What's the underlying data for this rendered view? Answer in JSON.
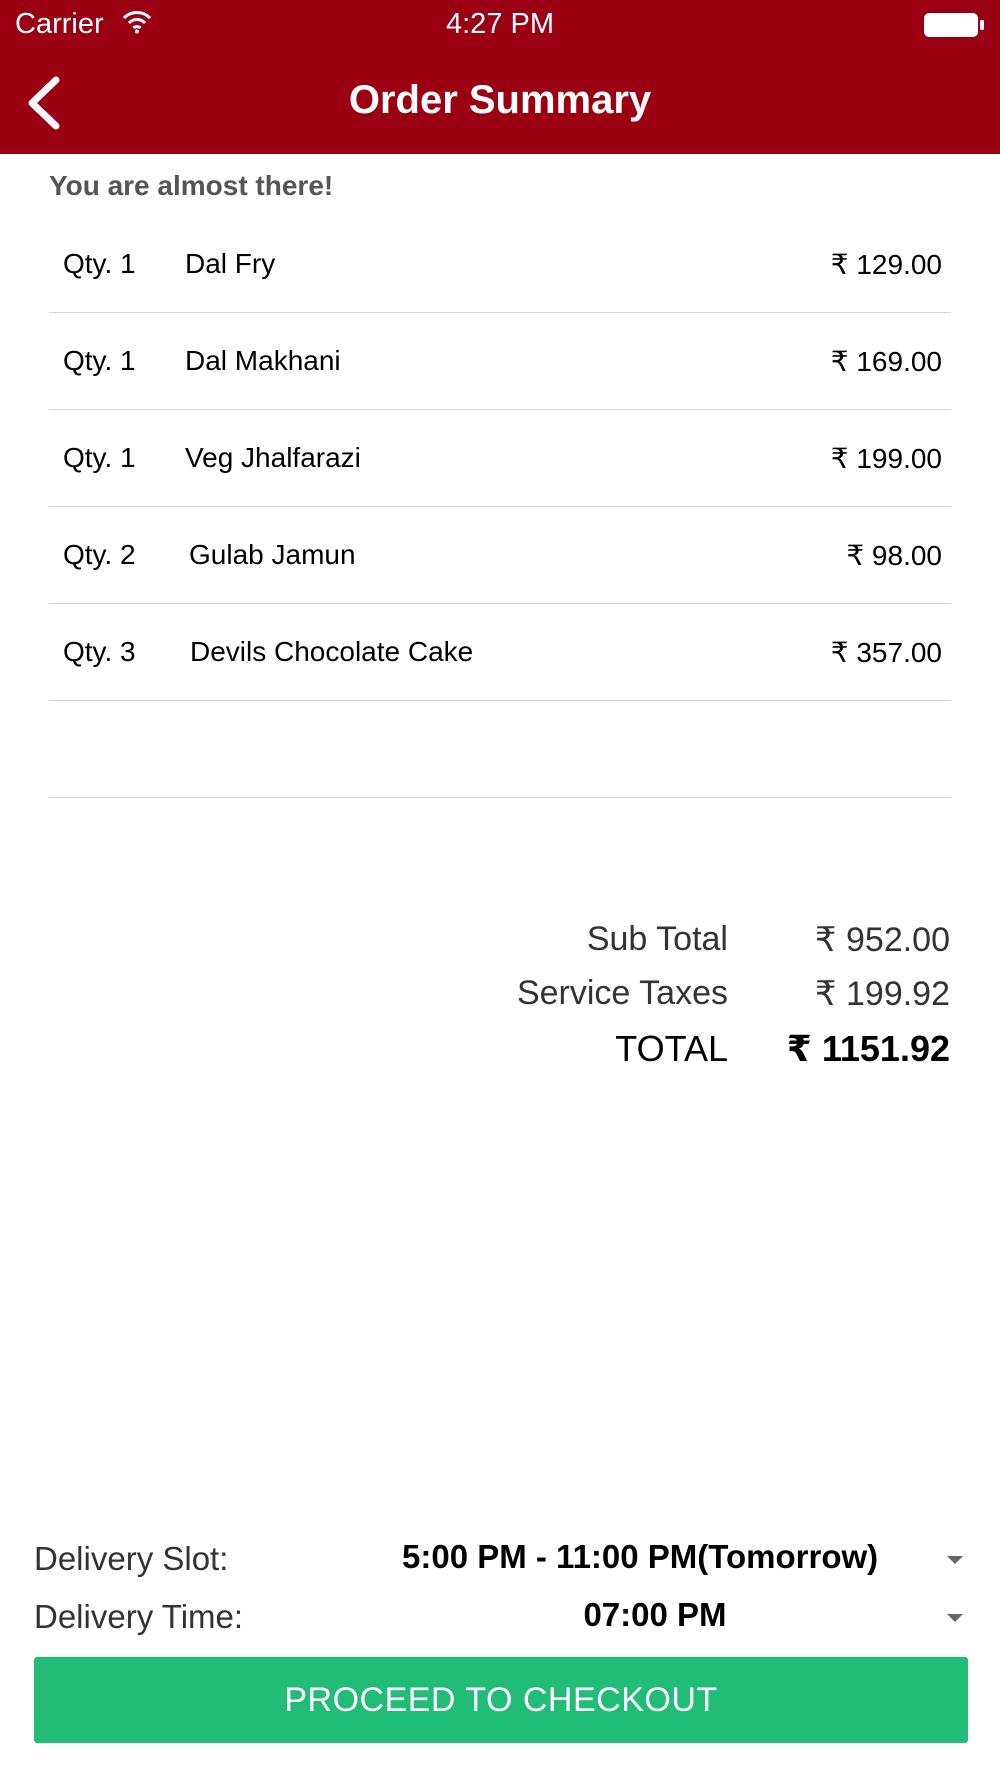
{
  "status_bar": {
    "carrier": "Carrier",
    "time": "4:27 PM"
  },
  "nav": {
    "title": "Order Summary",
    "back_icon": "chevron-left-icon"
  },
  "subtitle": "You are almost there!",
  "currency_symbol": "₹",
  "items": [
    {
      "qty_label": "Qty. 1",
      "name": "Dal Fry",
      "price": "₹ 129.00"
    },
    {
      "qty_label": "Qty. 1",
      "name": "Dal Makhani",
      "price": "₹ 169.00"
    },
    {
      "qty_label": "Qty. 1",
      "name": "Veg Jhalfarazi",
      "price": "₹ 199.00"
    },
    {
      "qty_label": "Qty. 2",
      "name": "Gulab Jamun",
      "price": "₹ 98.00"
    },
    {
      "qty_label": "Qty. 3",
      "name": "Devils Chocolate Cake",
      "price": "₹ 357.00"
    }
  ],
  "totals": {
    "sub_total_label": "Sub Total",
    "sub_total_value": "₹ 952.00",
    "tax_label": "Service Taxes",
    "tax_value": "₹ 199.92",
    "total_label": "TOTAL",
    "total_value": "₹ 1151.92"
  },
  "delivery": {
    "slot_label": "Delivery Slot:",
    "slot_value": "5:00 PM - 11:00 PM(Tomorrow)",
    "time_label": "Delivery Time:",
    "time_value": "07:00 PM"
  },
  "checkout_label": "PROCEED TO CHECKOUT",
  "colors": {
    "header": "#9b0012",
    "checkout": "#21bd78"
  }
}
